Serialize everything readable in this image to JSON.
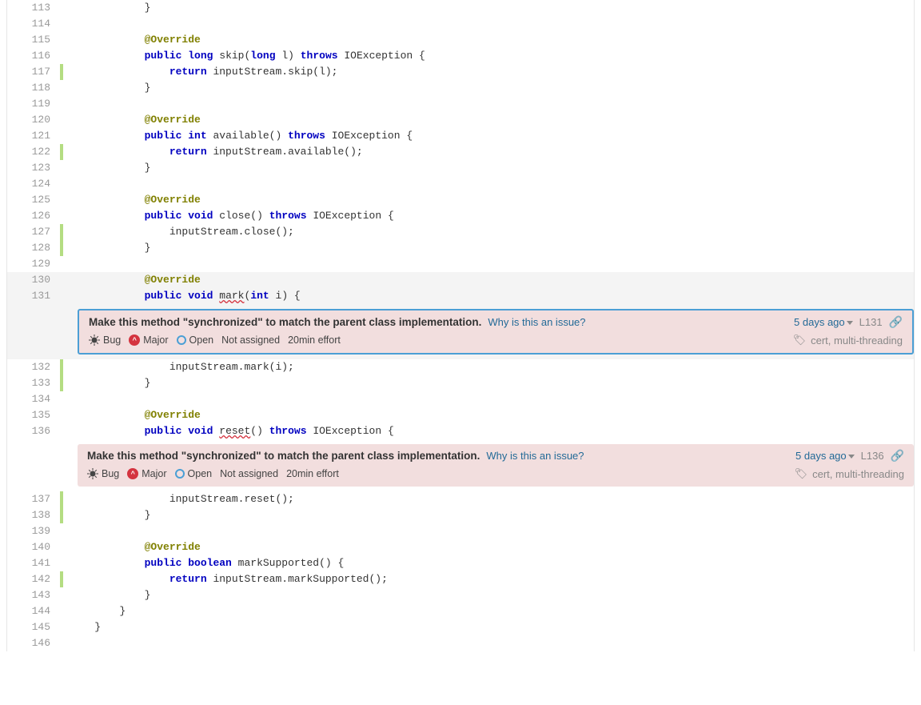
{
  "lines": [
    {
      "num": 113,
      "indent": 12,
      "tokens": [
        {
          "t": "sym",
          "v": "}"
        }
      ]
    },
    {
      "num": 114,
      "indent": 0,
      "tokens": []
    },
    {
      "num": 115,
      "indent": 12,
      "tokens": [
        {
          "t": "k-annot",
          "v": "@Override"
        }
      ]
    },
    {
      "num": 116,
      "indent": 12,
      "tokens": [
        {
          "t": "k-pub",
          "v": "public"
        },
        {
          "t": "sp"
        },
        {
          "t": "k-type",
          "v": "long"
        },
        {
          "t": "sp"
        },
        {
          "t": "sym",
          "v": "skip("
        },
        {
          "t": "k-type",
          "v": "long"
        },
        {
          "t": "sp"
        },
        {
          "t": "sym",
          "v": "l) "
        },
        {
          "t": "k-throws",
          "v": "throws"
        },
        {
          "t": "sp"
        },
        {
          "t": "sym",
          "v": "IOException {"
        }
      ]
    },
    {
      "num": 117,
      "indent": 16,
      "green": true,
      "tokens": [
        {
          "t": "k-ret",
          "v": "return"
        },
        {
          "t": "sp"
        },
        {
          "t": "sym",
          "v": "inputStream.skip(l);"
        }
      ]
    },
    {
      "num": 118,
      "indent": 12,
      "tokens": [
        {
          "t": "sym",
          "v": "}"
        }
      ]
    },
    {
      "num": 119,
      "indent": 0,
      "tokens": []
    },
    {
      "num": 120,
      "indent": 12,
      "tokens": [
        {
          "t": "k-annot",
          "v": "@Override"
        }
      ]
    },
    {
      "num": 121,
      "indent": 12,
      "tokens": [
        {
          "t": "k-pub",
          "v": "public"
        },
        {
          "t": "sp"
        },
        {
          "t": "k-type",
          "v": "int"
        },
        {
          "t": "sp"
        },
        {
          "t": "sym",
          "v": "available() "
        },
        {
          "t": "k-throws",
          "v": "throws"
        },
        {
          "t": "sp"
        },
        {
          "t": "sym",
          "v": "IOException {"
        }
      ]
    },
    {
      "num": 122,
      "indent": 16,
      "green": true,
      "tokens": [
        {
          "t": "k-ret",
          "v": "return"
        },
        {
          "t": "sp"
        },
        {
          "t": "sym",
          "v": "inputStream.available();"
        }
      ]
    },
    {
      "num": 123,
      "indent": 12,
      "tokens": [
        {
          "t": "sym",
          "v": "}"
        }
      ]
    },
    {
      "num": 124,
      "indent": 0,
      "tokens": []
    },
    {
      "num": 125,
      "indent": 12,
      "tokens": [
        {
          "t": "k-annot",
          "v": "@Override"
        }
      ]
    },
    {
      "num": 126,
      "indent": 12,
      "tokens": [
        {
          "t": "k-pub",
          "v": "public"
        },
        {
          "t": "sp"
        },
        {
          "t": "k-type",
          "v": "void"
        },
        {
          "t": "sp"
        },
        {
          "t": "sym",
          "v": "close() "
        },
        {
          "t": "k-throws",
          "v": "throws"
        },
        {
          "t": "sp"
        },
        {
          "t": "sym",
          "v": "IOException {"
        }
      ]
    },
    {
      "num": 127,
      "indent": 16,
      "green": true,
      "tokens": [
        {
          "t": "sym",
          "v": "inputStream.close();"
        }
      ]
    },
    {
      "num": 128,
      "indent": 12,
      "green": true,
      "tokens": [
        {
          "t": "sym",
          "v": "}"
        }
      ]
    },
    {
      "num": 129,
      "indent": 0,
      "tokens": []
    },
    {
      "num": 130,
      "indent": 12,
      "hl": true,
      "tokens": [
        {
          "t": "k-annot",
          "v": "@Override"
        }
      ]
    },
    {
      "num": 131,
      "indent": 12,
      "hl": true,
      "tokens": [
        {
          "t": "k-pub",
          "v": "public"
        },
        {
          "t": "sp"
        },
        {
          "t": "k-type",
          "v": "void"
        },
        {
          "t": "sp"
        },
        {
          "t": "sym",
          "v": "",
          "ul": true,
          "uv": "mark"
        },
        {
          "t": "sym",
          "v": "("
        },
        {
          "t": "k-type",
          "v": "int"
        },
        {
          "t": "sp"
        },
        {
          "t": "sym",
          "v": "i) {"
        }
      ]
    },
    {
      "issue": 0
    },
    {
      "num": 132,
      "indent": 16,
      "green": true,
      "tokens": [
        {
          "t": "sym",
          "v": "inputStream.mark(i);"
        }
      ]
    },
    {
      "num": 133,
      "indent": 12,
      "green": true,
      "tokens": [
        {
          "t": "sym",
          "v": "}"
        }
      ]
    },
    {
      "num": 134,
      "indent": 0,
      "tokens": []
    },
    {
      "num": 135,
      "indent": 12,
      "tokens": [
        {
          "t": "k-annot",
          "v": "@Override"
        }
      ]
    },
    {
      "num": 136,
      "indent": 12,
      "tokens": [
        {
          "t": "k-pub",
          "v": "public"
        },
        {
          "t": "sp"
        },
        {
          "t": "k-type",
          "v": "void"
        },
        {
          "t": "sp"
        },
        {
          "t": "sym",
          "v": "",
          "ul": true,
          "uv": "reset"
        },
        {
          "t": "sym",
          "v": "() "
        },
        {
          "t": "k-throws",
          "v": "throws"
        },
        {
          "t": "sp"
        },
        {
          "t": "sym",
          "v": "IOException {"
        }
      ]
    },
    {
      "issue": 1
    },
    {
      "num": 137,
      "indent": 16,
      "green": true,
      "tokens": [
        {
          "t": "sym",
          "v": "inputStream.reset();"
        }
      ]
    },
    {
      "num": 138,
      "indent": 12,
      "green": true,
      "tokens": [
        {
          "t": "sym",
          "v": "}"
        }
      ]
    },
    {
      "num": 139,
      "indent": 0,
      "tokens": []
    },
    {
      "num": 140,
      "indent": 12,
      "tokens": [
        {
          "t": "k-annot",
          "v": "@Override"
        }
      ]
    },
    {
      "num": 141,
      "indent": 12,
      "tokens": [
        {
          "t": "k-pub",
          "v": "public"
        },
        {
          "t": "sp"
        },
        {
          "t": "k-type",
          "v": "boolean"
        },
        {
          "t": "sp"
        },
        {
          "t": "sym",
          "v": "markSupported() {"
        }
      ]
    },
    {
      "num": 142,
      "indent": 16,
      "green": true,
      "tokens": [
        {
          "t": "k-ret",
          "v": "return"
        },
        {
          "t": "sp"
        },
        {
          "t": "sym",
          "v": "inputStream.markSupported();"
        }
      ]
    },
    {
      "num": 143,
      "indent": 12,
      "tokens": [
        {
          "t": "sym",
          "v": "}"
        }
      ]
    },
    {
      "num": 144,
      "indent": 8,
      "tokens": [
        {
          "t": "sym",
          "v": "}"
        }
      ]
    },
    {
      "num": 145,
      "indent": 4,
      "tokens": [
        {
          "t": "sym",
          "v": "}"
        }
      ]
    },
    {
      "num": 146,
      "indent": 0,
      "tokens": []
    }
  ],
  "issues": [
    {
      "selected": true,
      "hl": true,
      "message": "Make this method \"synchronized\" to match the parent class implementation.",
      "why": "Why is this an issue?",
      "age": "5 days ago",
      "loc": "L131",
      "type": "Bug",
      "severity": "Major",
      "status": "Open",
      "assignee": "Not assigned",
      "effort": "20min effort",
      "tags": "cert, multi-threading"
    },
    {
      "selected": false,
      "hl": false,
      "message": "Make this method \"synchronized\" to match the parent class implementation.",
      "why": "Why is this an issue?",
      "age": "5 days ago",
      "loc": "L136",
      "type": "Bug",
      "severity": "Major",
      "status": "Open",
      "assignee": "Not assigned",
      "effort": "20min effort",
      "tags": "cert, multi-threading"
    }
  ]
}
